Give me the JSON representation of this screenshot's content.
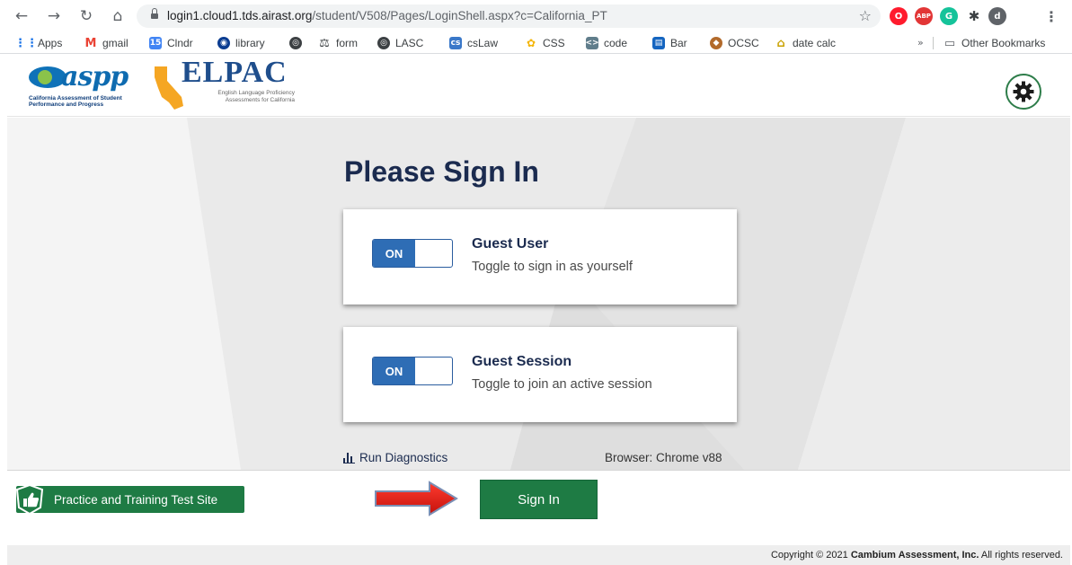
{
  "browser": {
    "url_host": "login1.cloud1.tds.airast.org",
    "url_path": "/student/V508/Pages/LoginShell.aspx?c=California_PT",
    "profile_initial": "d",
    "bookmarks": [
      {
        "label": "Apps",
        "icon": "apps-grid-icon"
      },
      {
        "label": "gmail",
        "icon": "gmail-icon"
      },
      {
        "label": "Clndr",
        "icon": "calendar-icon"
      },
      {
        "label": "library",
        "icon": "library-icon"
      },
      {
        "label": "",
        "icon": "globe-icon"
      },
      {
        "label": "form",
        "icon": "scales-icon"
      },
      {
        "label": "LASC",
        "icon": "globe-icon"
      },
      {
        "label": "csLaw",
        "icon": "cslaw-icon"
      },
      {
        "label": "CSS",
        "icon": "css-icon"
      },
      {
        "label": "code",
        "icon": "code-icon"
      },
      {
        "label": "Bar",
        "icon": "bar-icon"
      },
      {
        "label": "OCSC",
        "icon": "ocsc-icon"
      },
      {
        "label": "date calc",
        "icon": "date-calc-icon"
      }
    ],
    "more_bookmarks": "»",
    "other_bookmarks": "Other Bookmarks"
  },
  "header": {
    "caaspp_logo_text": "aspp",
    "caaspp_subtitle": "California Assessment of Student Performance and Progress",
    "elpac_logo_text": "ELPAC",
    "elpac_subtitle": "English Language Proficiency Assessments for California"
  },
  "signin": {
    "title": "Please Sign In",
    "guest_user": {
      "toggle": "ON",
      "title": "Guest User",
      "desc": "Toggle to sign in as yourself"
    },
    "guest_session": {
      "toggle": "ON",
      "title": "Guest Session",
      "desc": "Toggle to join an active session"
    },
    "run_diagnostics": "Run Diagnostics",
    "browser_info": "Browser: Chrome v88"
  },
  "footer": {
    "practice_label": "Practice and Training Test Site",
    "signin_button": "Sign In",
    "copyright_prefix": "Copyright © 2021 ",
    "copyright_company": "Cambium Assessment, Inc.",
    "copyright_suffix": " All rights reserved."
  },
  "colors": {
    "primary_green": "#1e7b44",
    "toggle_blue": "#2e6db5",
    "title_navy": "#1b2b4f",
    "arrow_red": "#e0211c"
  }
}
